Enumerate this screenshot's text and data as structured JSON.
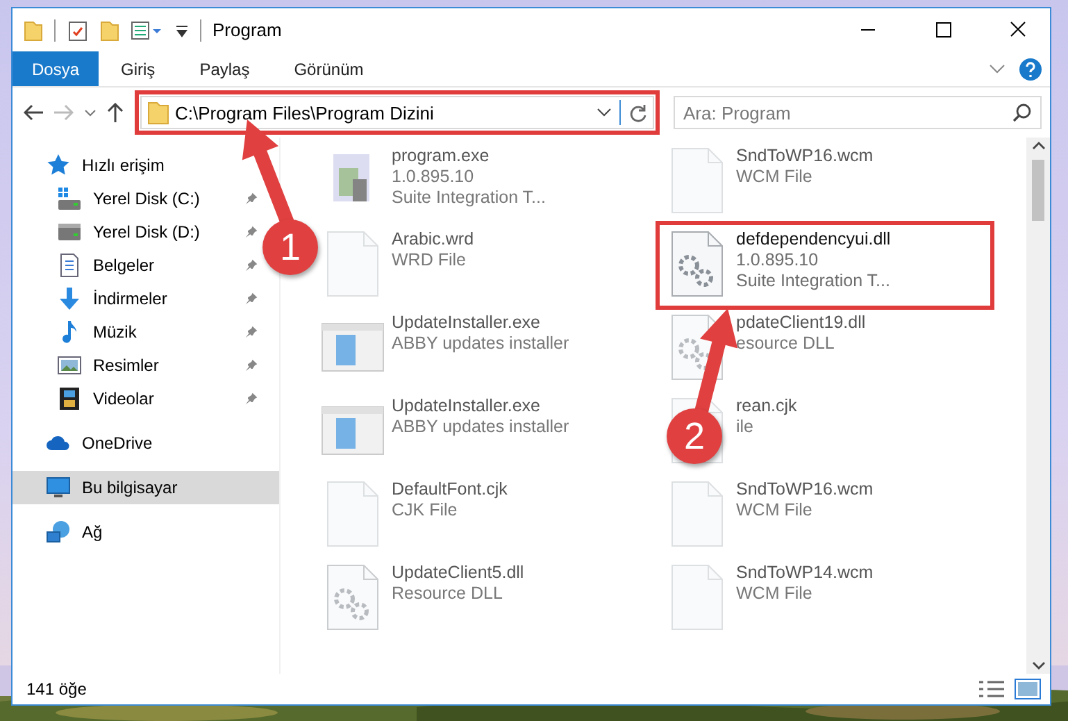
{
  "window": {
    "title": "Program"
  },
  "ribbon_tabs": [
    {
      "label": "Dosya",
      "selected": true
    },
    {
      "label": "Giriş",
      "selected": false
    },
    {
      "label": "Paylaş",
      "selected": false
    },
    {
      "label": "Görünüm",
      "selected": false
    }
  ],
  "address": {
    "path": "C:\\Program Files\\Program Dizini",
    "highlighted": true
  },
  "search": {
    "placeholder": "Ara: Program"
  },
  "navigation": [
    {
      "label": "Hızlı erişim",
      "kind": "star",
      "selected": false,
      "children": [
        {
          "label": "Yerel Disk (C:)",
          "kind": "system-drive",
          "pinned": true,
          "selected": false
        },
        {
          "label": "Yerel Disk (D:)",
          "kind": "drive",
          "pinned": true,
          "selected": false
        },
        {
          "label": "Belgeler",
          "kind": "documents",
          "pinned": true,
          "selected": false
        },
        {
          "label": "İndirmeler",
          "kind": "downloads",
          "pinned": true,
          "selected": false
        },
        {
          "label": "Müzik",
          "kind": "music",
          "pinned": true,
          "selected": false
        },
        {
          "label": "Resimler",
          "kind": "pictures",
          "pinned": true,
          "selected": false
        },
        {
          "label": "Videolar",
          "kind": "videos",
          "pinned": true,
          "selected": false
        }
      ]
    },
    {
      "label": "OneDrive",
      "kind": "cloud",
      "selected": false
    },
    {
      "label": "Bu bilgisayar",
      "kind": "computer",
      "selected": true
    },
    {
      "label": "Ağ",
      "kind": "network",
      "selected": false
    }
  ],
  "files": [
    {
      "name": "program.exe",
      "details": [
        "1.0.895.10",
        "Suite Integration T..."
      ],
      "kind": "program",
      "dimmed": true,
      "highlighted": false
    },
    {
      "name": "SndToWP16.wcm",
      "details": [
        "WCM File"
      ],
      "kind": "file",
      "dimmed": true,
      "highlighted": false
    },
    {
      "name": "Arabic.wrd",
      "details": [
        "WRD File"
      ],
      "kind": "file",
      "dimmed": true,
      "highlighted": false
    },
    {
      "name": "defdependencyui.dll",
      "details": [
        "1.0.895.10",
        "Suite Integration T..."
      ],
      "kind": "library",
      "dimmed": false,
      "highlighted": true
    },
    {
      "name": "UpdateInstaller.exe",
      "details": [
        "ABBY updates installer"
      ],
      "kind": "installer",
      "dimmed": true,
      "highlighted": false
    },
    {
      "name": "pdateClient19.dll",
      "details": [
        "esource DLL"
      ],
      "kind": "library",
      "dimmed": true,
      "highlighted": false
    },
    {
      "name": "UpdateInstaller.exe",
      "details": [
        "ABBY updates installer"
      ],
      "kind": "installer",
      "dimmed": true,
      "highlighted": false
    },
    {
      "name": "rean.cjk",
      "details": [
        "ile"
      ],
      "kind": "file",
      "dimmed": true,
      "highlighted": false
    },
    {
      "name": "DefaultFont.cjk",
      "details": [
        "CJK File"
      ],
      "kind": "file",
      "dimmed": true,
      "highlighted": false
    },
    {
      "name": "SndToWP16.wcm",
      "details": [
        "WCM File"
      ],
      "kind": "file",
      "dimmed": true,
      "highlighted": false
    },
    {
      "name": "UpdateClient5.dll",
      "details": [
        "Resource DLL"
      ],
      "kind": "library",
      "dimmed": true,
      "highlighted": false
    },
    {
      "name": "SndToWP14.wcm",
      "details": [
        "WCM File"
      ],
      "kind": "file",
      "dimmed": true,
      "highlighted": false
    }
  ],
  "status_bar": {
    "item_count": "141 öğe"
  },
  "annotations": [
    {
      "number": "1"
    },
    {
      "number": "2"
    }
  ]
}
